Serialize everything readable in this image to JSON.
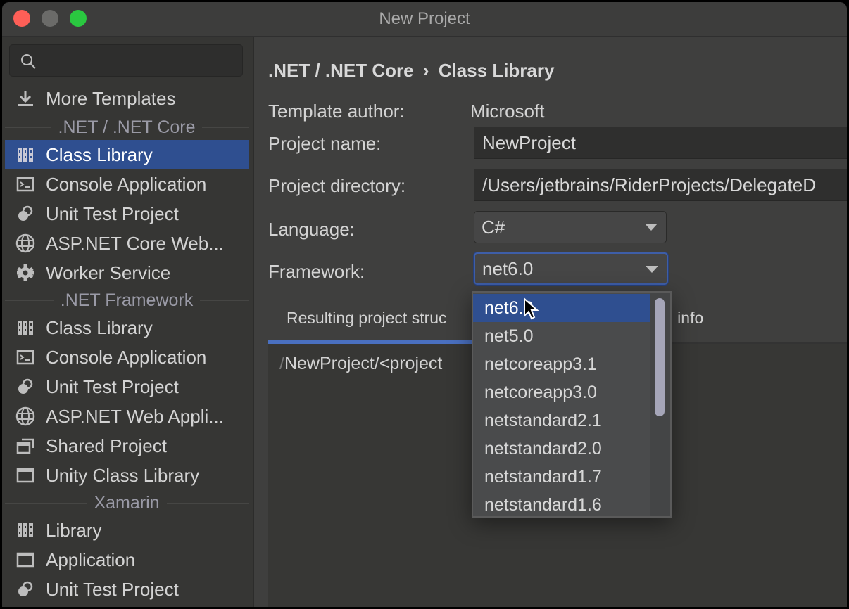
{
  "window": {
    "title": "New Project"
  },
  "sidebar": {
    "search": {
      "placeholder": "",
      "value": ""
    },
    "more_templates": {
      "label": "More Templates",
      "icon": "download-icon"
    },
    "groups": [
      {
        "title": ".NET / .NET Core",
        "items": [
          {
            "label": "Class Library",
            "icon": "library-icon",
            "selected": true
          },
          {
            "label": "Console Application",
            "icon": "console-icon"
          },
          {
            "label": "Unit Test Project",
            "icon": "unit-test-icon"
          },
          {
            "label": "ASP.NET Core Web...",
            "icon": "globe-icon"
          },
          {
            "label": "Worker Service",
            "icon": "gear-icon"
          }
        ]
      },
      {
        "title": ".NET Framework",
        "items": [
          {
            "label": "Class Library",
            "icon": "library-icon"
          },
          {
            "label": "Console Application",
            "icon": "console-icon"
          },
          {
            "label": "Unit Test Project",
            "icon": "unit-test-icon"
          },
          {
            "label": "ASP.NET Web Appli...",
            "icon": "globe-icon"
          },
          {
            "label": "Shared Project",
            "icon": "shared-project-icon"
          },
          {
            "label": "Unity Class Library",
            "icon": "window-icon"
          }
        ]
      },
      {
        "title": "Xamarin",
        "items": [
          {
            "label": "Library",
            "icon": "library-icon"
          },
          {
            "label": "Application",
            "icon": "window-icon"
          },
          {
            "label": "Unit Test Project",
            "icon": "unit-test-icon"
          }
        ]
      }
    ]
  },
  "main": {
    "breadcrumb": {
      "parent": ".NET / .NET Core",
      "separator": "›",
      "current": "Class Library"
    },
    "template_author": {
      "label": "Template author:",
      "value": "Microsoft"
    },
    "project_name": {
      "label": "Project name:",
      "value": "NewProject"
    },
    "project_directory": {
      "label": "Project directory:",
      "value": "/Users/jetbrains/RiderProjects/DelegateD"
    },
    "language": {
      "label": "Language:",
      "value": "C#"
    },
    "framework": {
      "label": "Framework:",
      "value": "net6.0",
      "options": [
        "net6.0",
        "net5.0",
        "netcoreapp3.1",
        "netcoreapp3.0",
        "netstandard2.1",
        "netstandard2.0",
        "netstandard1.7",
        "netstandard1.6"
      ],
      "highlighted": "net6.0"
    },
    "tabs": [
      {
        "label": "Resulting project struc",
        "active": true
      },
      {
        "label": "e info",
        "active": false
      }
    ],
    "structure_path": {
      "slash": "/",
      "text": "NewProject/<project"
    }
  },
  "colors": {
    "selection": "#2f4f90",
    "accent": "#4a70c0",
    "close": "#fe5f57",
    "zoom": "#2ac840"
  }
}
